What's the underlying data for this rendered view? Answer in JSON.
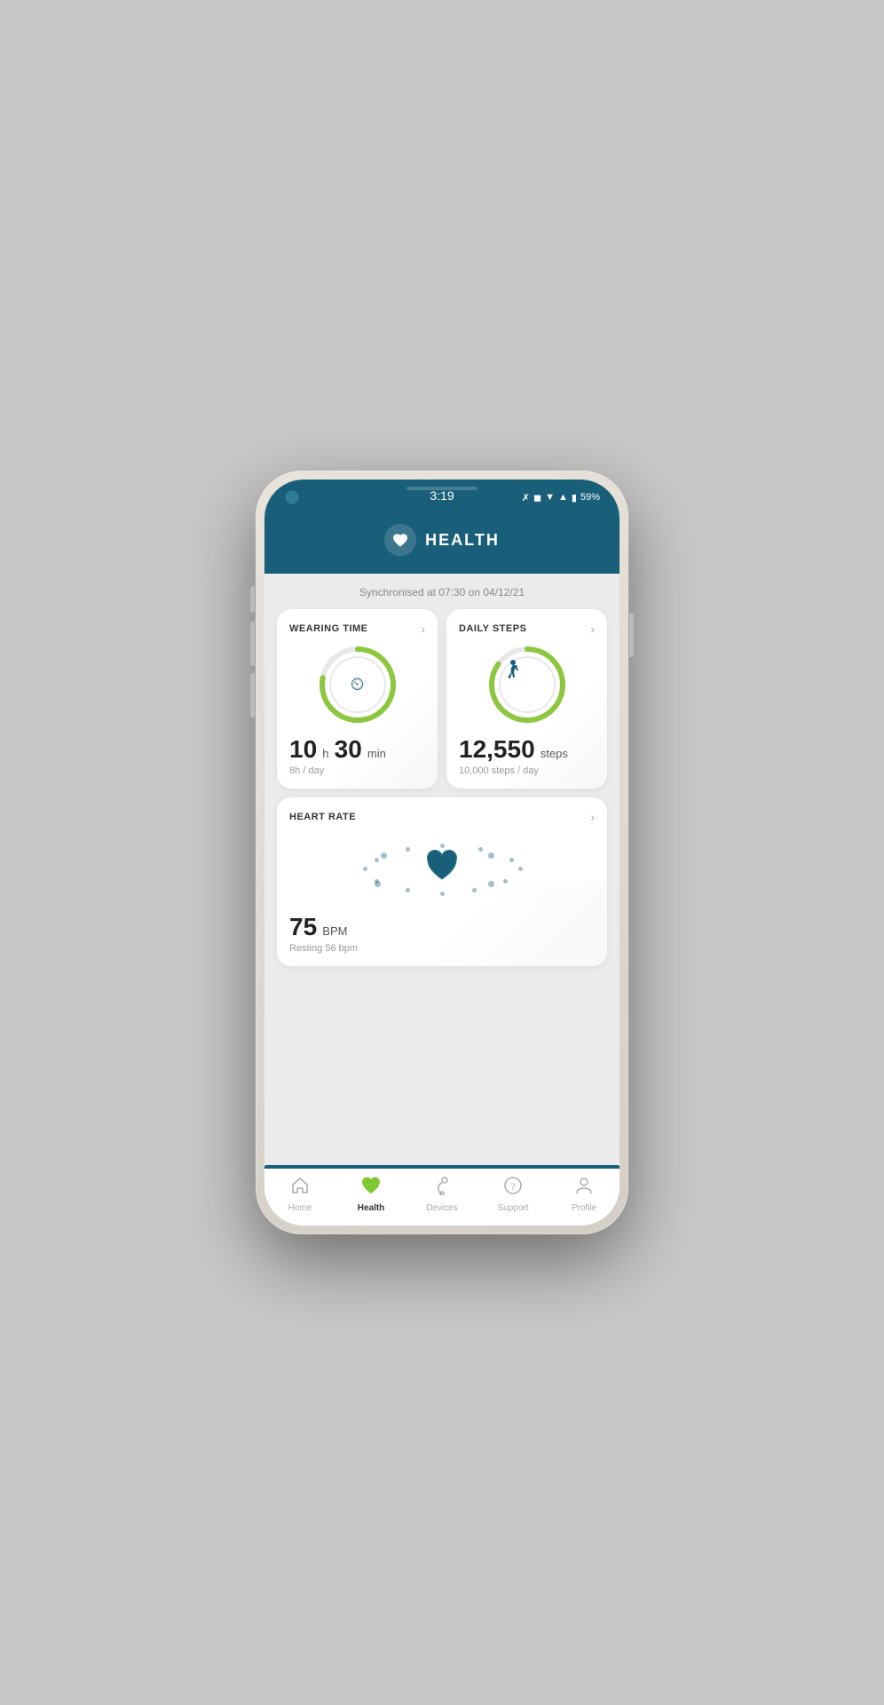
{
  "statusBar": {
    "time": "3:19",
    "battery": "59%"
  },
  "header": {
    "title": "HEALTH"
  },
  "sync": {
    "text": "Synchronised at 07:30 on 04/12/21"
  },
  "wearingTime": {
    "label": "WEARING TIME",
    "value_h": "10",
    "unit_h": "h",
    "value_min": "30",
    "unit_min": "min",
    "sub": "8h / day",
    "progress": 0.78
  },
  "dailySteps": {
    "label": "DAILY STEPS",
    "value": "12,550",
    "unit": "steps",
    "sub": "10,000 steps / day",
    "progress": 0.85
  },
  "heartRate": {
    "label": "HEART RATE",
    "value": "75",
    "unit": "BPM",
    "sub": "Resting 56 bpm",
    "progress": 0.6
  },
  "tabs": [
    {
      "id": "home",
      "label": "Home",
      "active": false
    },
    {
      "id": "health",
      "label": "Health",
      "active": true
    },
    {
      "id": "devices",
      "label": "Devices",
      "active": false
    },
    {
      "id": "support",
      "label": "Support",
      "active": false
    },
    {
      "id": "profile",
      "label": "Profile",
      "active": false
    }
  ]
}
